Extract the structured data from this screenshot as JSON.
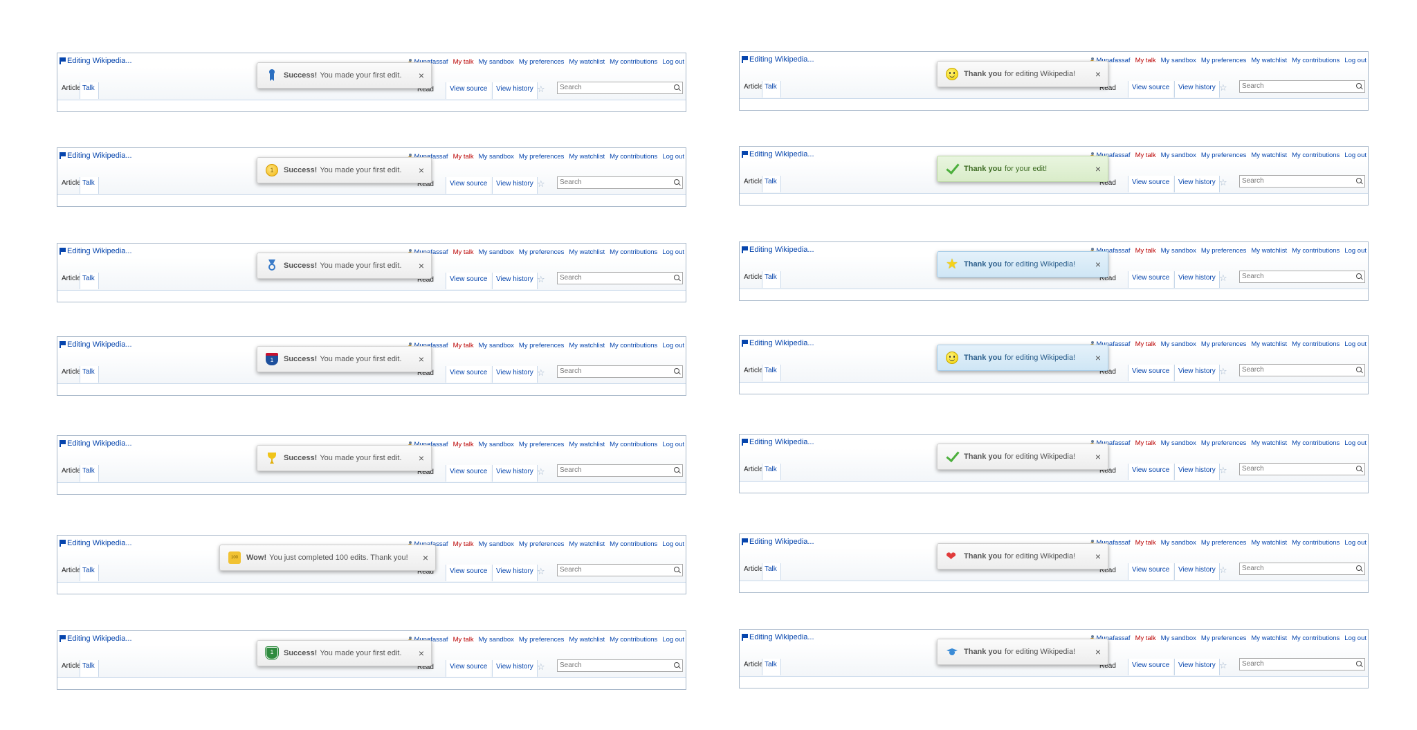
{
  "header": {
    "editing_label": "Editing Wikipedia...",
    "username": "Munafassaf",
    "my_talk": "My talk",
    "my_sandbox": "My sandbox",
    "my_preferences": "My preferences",
    "my_watchlist": "My watchlist",
    "my_contributions": "My contributions",
    "log_out": "Log out"
  },
  "tabs": {
    "article": "Article",
    "talk": "Talk",
    "read": "Read",
    "view_source": "View source",
    "view_history": "View history",
    "search_placeholder": "Search"
  },
  "colors": {
    "link": "#0645ad",
    "user_red": "#ba0000",
    "green_bg": "#dcefcd",
    "blue_bg": "#d6eaf7"
  },
  "notifications_left": [
    {
      "icon": "ribbon-icon",
      "bold": "Success!",
      "text": "You made your first edit.",
      "style": "gray"
    },
    {
      "icon": "coin-icon",
      "bold": "Success!",
      "text": "You made your first edit.",
      "style": "gray",
      "icon_text": "1"
    },
    {
      "icon": "medal-icon",
      "bold": "Success!",
      "text": "You made your first edit.",
      "style": "gray"
    },
    {
      "icon": "interstate-shield-icon",
      "bold": "Success!",
      "text": "You made your first edit.",
      "style": "gray",
      "icon_text": "1"
    },
    {
      "icon": "trophy-icon",
      "bold": "Success!",
      "text": "You made your first edit.",
      "style": "gray"
    },
    {
      "icon": "puzzle-piece-icon",
      "bold": "Wow!",
      "text": "You just completed 100 edits. Thank you!",
      "style": "gray",
      "icon_text": "100"
    },
    {
      "icon": "highway-sign-icon",
      "bold": "Success!",
      "text": "You made your first edit.",
      "style": "gray",
      "icon_text": "1"
    }
  ],
  "notifications_right": [
    {
      "icon": "smiley-icon",
      "bold": "Thank you",
      "text": "for editing Wikipedia!",
      "style": "gray"
    },
    {
      "icon": "checkmark-icon",
      "bold": "Thank you",
      "text": "for your edit!",
      "style": "green"
    },
    {
      "icon": "star-icon",
      "bold": "Thank you",
      "text": "for editing Wikipedia!",
      "style": "blue"
    },
    {
      "icon": "smiley-icon",
      "bold": "Thank you",
      "text": "for editing Wikipedia!",
      "style": "blue"
    },
    {
      "icon": "checkmark-icon",
      "bold": "Thank you",
      "text": "for editing Wikipedia!",
      "style": "gray"
    },
    {
      "icon": "heart-icon",
      "bold": "Thank you",
      "text": "for editing Wikipedia!",
      "style": "gray"
    },
    {
      "icon": "graduation-cap-icon",
      "bold": "Thank you",
      "text": "for editing Wikipedia!",
      "style": "gray"
    }
  ],
  "close_glyph": "×",
  "star_glyph": "☆",
  "icon_glyphs": {
    "star": "★",
    "heart": "❤"
  }
}
